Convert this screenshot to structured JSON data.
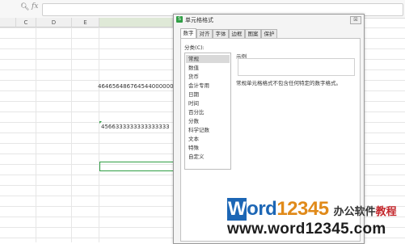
{
  "formula_bar": {
    "zoom_icon": "magnifier-icon",
    "fx_label": "fx",
    "value": ""
  },
  "columns": [
    "C",
    "D",
    "E",
    ""
  ],
  "cells": {
    "long_number_1": "46465648676454400000000",
    "long_number_2": "4566333333333333333"
  },
  "dialog": {
    "title": "单元格格式",
    "close_label": "☒",
    "tabs": [
      "数字",
      "对齐",
      "字体",
      "边框",
      "图案",
      "保护"
    ],
    "active_tab": "数字",
    "category_label": "分类(C):",
    "categories": [
      "常规",
      "数值",
      "货币",
      "会计专用",
      "日期",
      "时间",
      "百分比",
      "分数",
      "科学记数",
      "文本",
      "特殊",
      "自定义"
    ],
    "selected_category": "常规",
    "sample_label": "示例",
    "sample_value": "",
    "description": "常规单元格格式不包含任何特定的数字格式。"
  },
  "watermark": {
    "logo_letter": "W",
    "logo_word": "ord",
    "logo_number": "12345",
    "tagline_part1": "办公软件",
    "tagline_part2": "教程",
    "url": "www.word12345.com"
  },
  "colors": {
    "accent": "#2f9e44",
    "brand_blue": "#1c66b5",
    "brand_orange": "#e08a1a"
  }
}
